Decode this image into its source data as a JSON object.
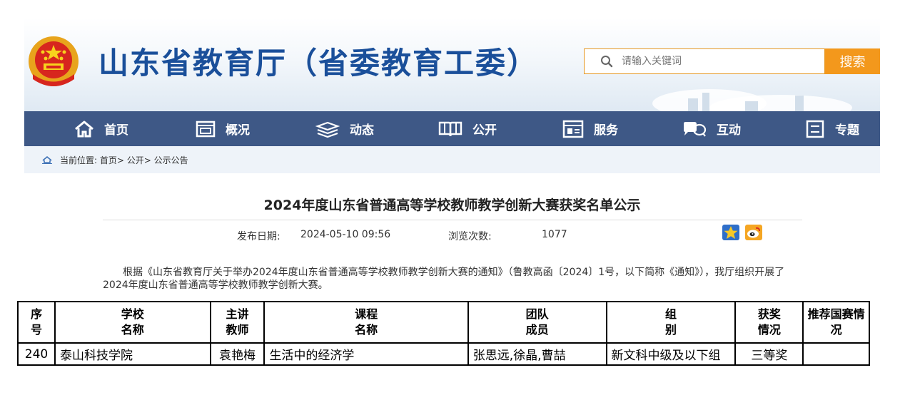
{
  "header": {
    "site_title": "山东省教育厅（省委教育工委）",
    "search_placeholder": "请输入关键词",
    "search_button": "搜索"
  },
  "nav": {
    "items": [
      {
        "label": "首页",
        "icon": "home-icon"
      },
      {
        "label": "概况",
        "icon": "overview-icon"
      },
      {
        "label": "动态",
        "icon": "news-icon"
      },
      {
        "label": "公开",
        "icon": "book-icon"
      },
      {
        "label": "服务",
        "icon": "service-icon"
      },
      {
        "label": "互动",
        "icon": "chat-icon"
      },
      {
        "label": "专题",
        "icon": "topic-icon"
      }
    ]
  },
  "breadcrumb": {
    "text": "当前位置: 首页> 公开> 公示公告"
  },
  "article": {
    "title": "2024年度山东省普通高等学校教师教学创新大赛获奖名单公示",
    "publish_label": "发布日期:",
    "publish_date": "2024-05-10 09:56",
    "views_label": "浏览次数:",
    "views_count": "1077",
    "body": "根据《山东省教育厅关于举办2024年度山东省普通高等学校教师教学创新大赛的通知》（鲁教高函〔2024〕1号，以下简称《通知》），我厅组织开展了2024年度山东省普通高等学校教师教学创新大赛。"
  },
  "table": {
    "headers": [
      "序号",
      "学校名称",
      "主讲教师",
      "课程名称",
      "团队成员",
      "组别",
      "获奖情况",
      "推荐国赛情况"
    ],
    "rows": [
      [
        "240",
        "泰山科技学院",
        "袁艳梅",
        "生活中的经济学",
        "张思远,徐晶,曹喆",
        "新文科中级及以下组",
        "三等奖",
        ""
      ]
    ]
  },
  "colors": {
    "title_blue": "#1a4f9a",
    "nav_bg": "#3e5886",
    "search_orange": "#f3981c",
    "breadcrumb_bg": "#eef3f9"
  }
}
